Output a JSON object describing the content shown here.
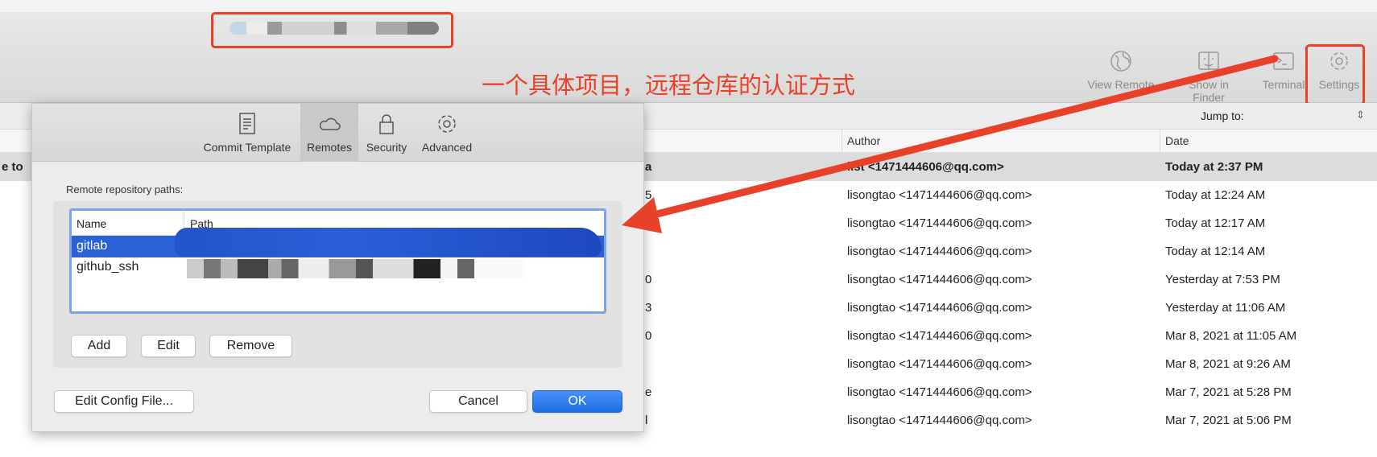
{
  "annotation": {
    "text": "一个具体项目，远程仓库的认证方式",
    "color": "#e8412a"
  },
  "toolbar": {
    "buttons": [
      {
        "label": "View Remote",
        "icon": "globe-icon"
      },
      {
        "label": "Show in Finder",
        "icon": "finder-icon"
      },
      {
        "label": "Terminal",
        "icon": "terminal-icon"
      },
      {
        "label": "Settings",
        "icon": "gear-icon"
      }
    ],
    "jump_to": "Jump to:"
  },
  "history": {
    "columns": {
      "author": "Author",
      "date": "Date"
    },
    "rows": [
      {
        "left": "e to",
        "msg": "a",
        "author": "list <1471444606@qq.com>",
        "date": "Today at 2:37 PM"
      },
      {
        "left": "",
        "msg": "5",
        "author": "lisongtao <1471444606@qq.com>",
        "date": "Today at 12:24 AM"
      },
      {
        "left": "",
        "msg": "",
        "author": "lisongtao <1471444606@qq.com>",
        "date": "Today at 12:17 AM"
      },
      {
        "left": "",
        "msg": "",
        "author": "lisongtao <1471444606@qq.com>",
        "date": "Today at 12:14 AM"
      },
      {
        "left": "",
        "msg": "0",
        "author": "lisongtao <1471444606@qq.com>",
        "date": "Yesterday at 7:53 PM"
      },
      {
        "left": "",
        "msg": "3",
        "author": "lisongtao <1471444606@qq.com>",
        "date": "Yesterday at 11:06 AM"
      },
      {
        "left": "",
        "msg": "0",
        "author": "lisongtao <1471444606@qq.com>",
        "date": "Mar 8, 2021 at 11:05 AM"
      },
      {
        "left": "",
        "msg": "",
        "author": "lisongtao <1471444606@qq.com>",
        "date": "Mar 8, 2021 at 9:26 AM"
      },
      {
        "left": "",
        "msg": "e",
        "author": "lisongtao <1471444606@qq.com>",
        "date": "Mar 7, 2021 at 5:28 PM"
      },
      {
        "left": "",
        "msg": "l",
        "author": "lisongtao <1471444606@qq.com>",
        "date": "Mar 7, 2021 at 5:06 PM"
      }
    ]
  },
  "dialog": {
    "tabs": [
      {
        "label": "Commit Template",
        "icon": "document-icon"
      },
      {
        "label": "Remotes",
        "icon": "cloud-icon",
        "active": true
      },
      {
        "label": "Security",
        "icon": "lock-icon"
      },
      {
        "label": "Advanced",
        "icon": "gear-icon"
      }
    ],
    "section_label": "Remote repository paths:",
    "table": {
      "columns": [
        "Name",
        "Path"
      ],
      "rows": [
        {
          "name": "gitlab",
          "selected": true
        },
        {
          "name": "github_ssh"
        }
      ]
    },
    "buttons": {
      "add": "Add",
      "edit": "Edit",
      "remove": "Remove",
      "edit_config": "Edit Config File...",
      "cancel": "Cancel",
      "ok": "OK"
    },
    "selection_color": "#2a62d6"
  }
}
